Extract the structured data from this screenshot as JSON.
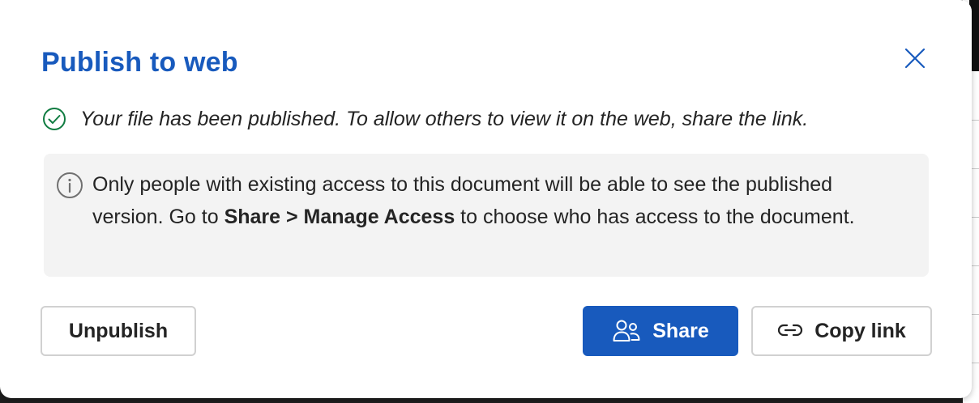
{
  "dialog": {
    "title": "Publish to web",
    "success_message": "Your file has been published. To allow others to view it on the web, share the link.",
    "info": {
      "text_before": "Only people with existing access to this document will be able to see the published version. Go to ",
      "bold_text": "Share > Manage Access",
      "text_after": " to choose who has access to the document."
    },
    "buttons": {
      "unpublish": "Unpublish",
      "share": "Share",
      "copy_link": "Copy link"
    }
  },
  "colors": {
    "accent": "#185abd",
    "success": "#107c41",
    "info_background": "#f3f3f3"
  },
  "icons": {
    "close": "close-icon",
    "success": "checkmark-circle-icon",
    "info": "info-icon",
    "share": "people-icon",
    "copy_link": "link-icon"
  }
}
